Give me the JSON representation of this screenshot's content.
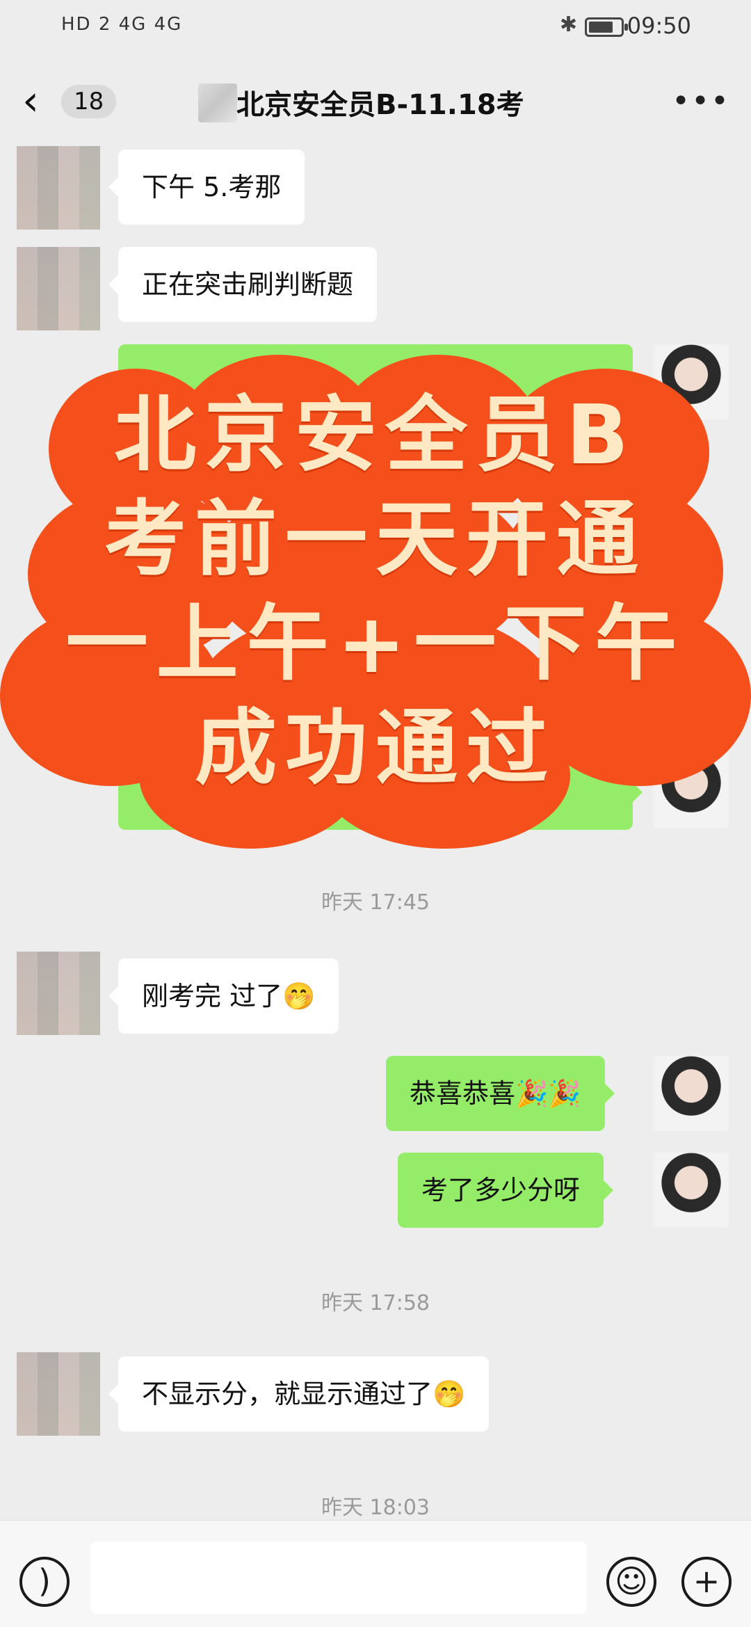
{
  "status": {
    "signal": "HD 2 4G 4G",
    "time": "09:50"
  },
  "header": {
    "back_count": "18",
    "title": "北京安全员B-11.18考"
  },
  "messages": [
    {
      "side": "in",
      "text": "下午 5.考那"
    },
    {
      "side": "in",
      "text": "正在突击刷判断题"
    },
    {
      "side": "in",
      "text": "刚考完 过了🤭"
    },
    {
      "side": "out",
      "text": "恭喜恭喜🎉🎉"
    },
    {
      "side": "out",
      "text": "考了多少分呀"
    },
    {
      "side": "in",
      "text": "不显示分，就显示通过了🤭"
    }
  ],
  "timestamps": [
    "昨天 17:45",
    "昨天 17:58",
    "昨天 18:03"
  ],
  "overlay": {
    "lines": [
      "北京安全员B",
      "考前一天开通",
      "一上午+一下午",
      "成功通过"
    ],
    "color": "#f5501b",
    "text_color": "#ffe8c4"
  },
  "footer": {
    "voice_icon": "voice-icon",
    "emoji_icon": "emoji-icon",
    "plus_icon": "plus-icon"
  }
}
